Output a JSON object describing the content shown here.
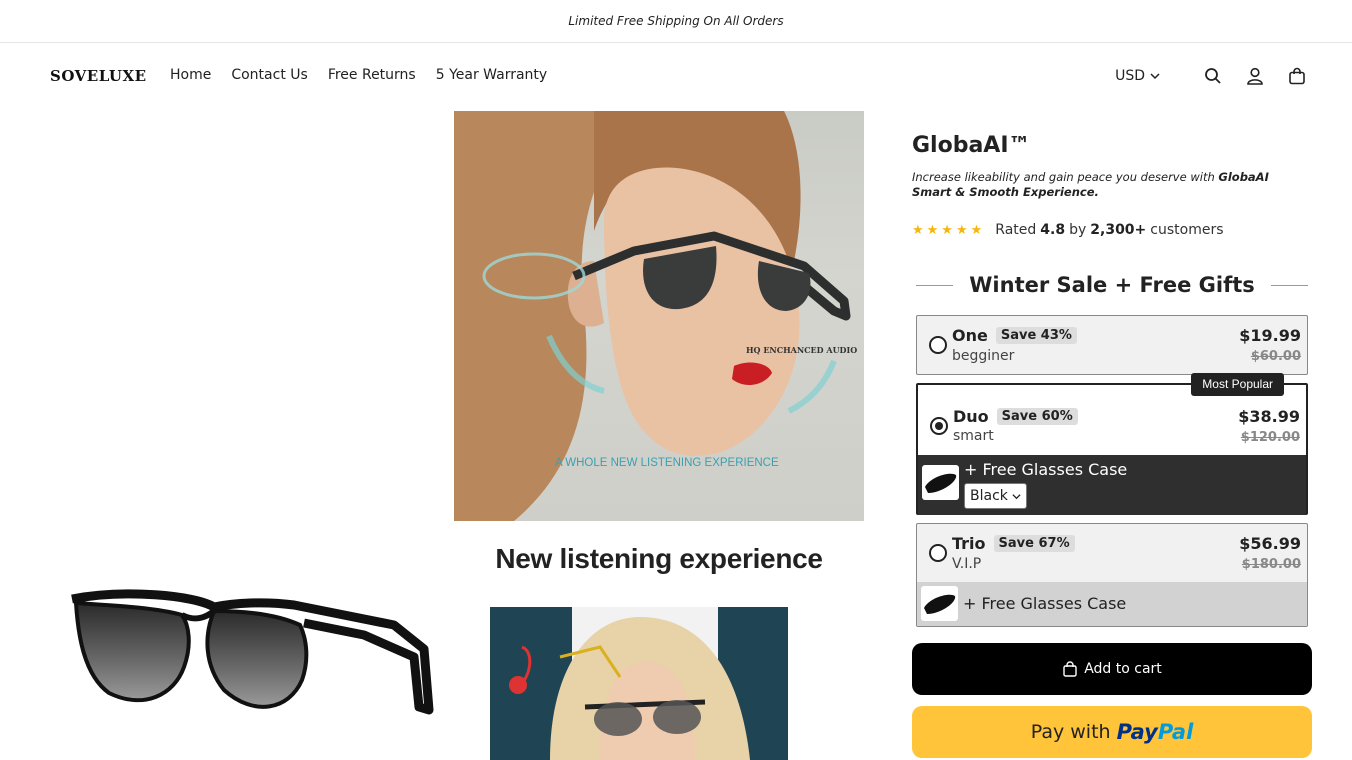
{
  "announcement": "Limited Free Shipping On All Orders",
  "header": {
    "logo": "SOVELUXE",
    "nav": [
      "Home",
      "Contact Us",
      "Free Returns",
      "5 Year Warranty"
    ],
    "currency": "USD"
  },
  "gallery": {
    "hero_overlay_top": "HQ ENCHANCED AUDIO",
    "hero_overlay_bottom": "A WHOLE NEW LISTENING EXPERIENCE",
    "caption": "New listening experience"
  },
  "product": {
    "title": "GlobaAI™",
    "subtitle_pre": "Increase likeability and gain peace you deserve with ",
    "subtitle_bold": "GlobaAI Smart & Smooth Experience.",
    "stars": "★★★★★",
    "rating_pre": "Rated",
    "rating_value": "4.8",
    "rating_mid": "by",
    "rating_count": "2,300+",
    "rating_post": "customers"
  },
  "offers": {
    "heading": "Winter Sale + Free Gifts",
    "items": [
      {
        "name": "One",
        "save": "Save 43%",
        "tier": "begginer",
        "price": "$19.99",
        "old_price": "$60.00"
      },
      {
        "name": "Duo",
        "save": "Save 60%",
        "tier": "smart",
        "price": "$38.99",
        "old_price": "$120.00",
        "badge": "Most Popular",
        "gift": "+ Free Glasses Case",
        "color": "Black"
      },
      {
        "name": "Trio",
        "save": "Save 67%",
        "tier": "V.I.P",
        "price": "$56.99",
        "old_price": "$180.00",
        "gift": "+ Free Glasses Case"
      }
    ]
  },
  "actions": {
    "add_to_cart": "Add to cart",
    "paypal_pre": "Pay with",
    "paypal_1": "Pay",
    "paypal_2": "Pal"
  }
}
